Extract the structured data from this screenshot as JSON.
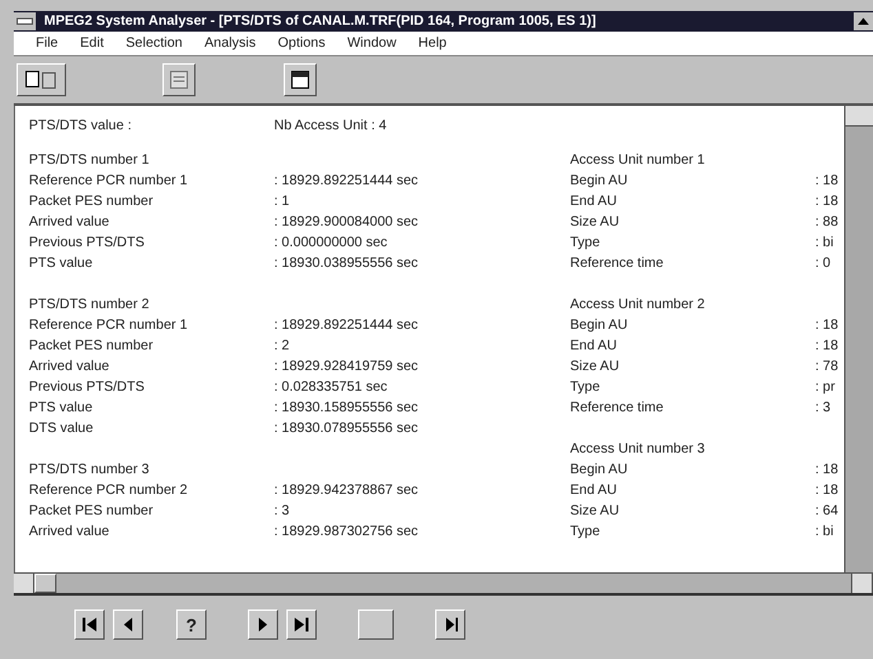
{
  "window": {
    "title": "MPEG2 System Analyser - [PTS/DTS of CANAL.M.TRF(PID 164, Program 1005, ES 1)]"
  },
  "menu": [
    "File",
    "Edit",
    "Selection",
    "Analysis",
    "Options",
    "Window",
    "Help"
  ],
  "toolbar": [
    {
      "kind": "copy"
    },
    {
      "kind": "list"
    },
    {
      "kind": "window"
    }
  ],
  "summary": {
    "label": "PTS/DTS value :",
    "count": "Nb Access Unit : 4"
  },
  "pts_blocks": [
    {
      "heading": "PTS/DTS number 1",
      "rows": [
        {
          "label": "Reference PCR number 1",
          "value": ": 18929.892251444 sec"
        },
        {
          "label": "Packet PES number",
          "value": ": 1"
        },
        {
          "label": "Arrived value",
          "value": ": 18929.900084000 sec"
        },
        {
          "label": "Previous PTS/DTS",
          "value": ": 0.000000000 sec"
        },
        {
          "label": "PTS value",
          "value": ": 18930.038955556 sec"
        }
      ]
    },
    {
      "heading": "PTS/DTS number 2",
      "rows": [
        {
          "label": "Reference PCR number 1",
          "value": ": 18929.892251444 sec"
        },
        {
          "label": "Packet PES number",
          "value": ": 2"
        },
        {
          "label": "Arrived value",
          "value": ": 18929.928419759 sec"
        },
        {
          "label": "Previous PTS/DTS",
          "value": ": 0.028335751 sec"
        },
        {
          "label": "PTS value",
          "value": ": 18930.158955556 sec"
        },
        {
          "label": "DTS value",
          "value": ": 18930.078955556 sec"
        }
      ]
    },
    {
      "heading": "PTS/DTS number 3",
      "rows": [
        {
          "label": "Reference PCR number 2",
          "value": ": 18929.942378867 sec"
        },
        {
          "label": "Packet PES number",
          "value": ": 3"
        },
        {
          "label": "Arrived value",
          "value": ": 18929.987302756 sec"
        }
      ]
    }
  ],
  "au_blocks": [
    {
      "heading": "Access Unit number 1",
      "rows": [
        {
          "label": "Begin AU",
          "value": ": 18"
        },
        {
          "label": "End AU",
          "value": ": 18"
        },
        {
          "label": "Size AU",
          "value": ": 88"
        },
        {
          "label": "Type",
          "value": ": bi"
        },
        {
          "label": "Reference time",
          "value": ": 0"
        }
      ]
    },
    {
      "heading": "Access Unit number 2",
      "rows": [
        {
          "label": "Begin AU",
          "value": ": 18"
        },
        {
          "label": "End AU",
          "value": ": 18"
        },
        {
          "label": "Size AU",
          "value": ": 78"
        },
        {
          "label": "Type",
          "value": ": pr"
        },
        {
          "label": "Reference time",
          "value": ": 3"
        }
      ]
    },
    {
      "heading": "Access Unit number 3",
      "rows": [
        {
          "label": "Begin AU",
          "value": ": 18"
        },
        {
          "label": "End AU",
          "value": ": 18"
        },
        {
          "label": "Size AU",
          "value": ": 64"
        },
        {
          "label": "Type",
          "value": ": bi"
        }
      ]
    }
  ],
  "bottom_toolbar": [
    {
      "kind": "first"
    },
    {
      "kind": "prev"
    },
    {
      "kind": "help",
      "label": "?"
    },
    {
      "kind": "next"
    },
    {
      "kind": "last"
    },
    {
      "kind": "blank"
    },
    {
      "kind": "play"
    }
  ]
}
